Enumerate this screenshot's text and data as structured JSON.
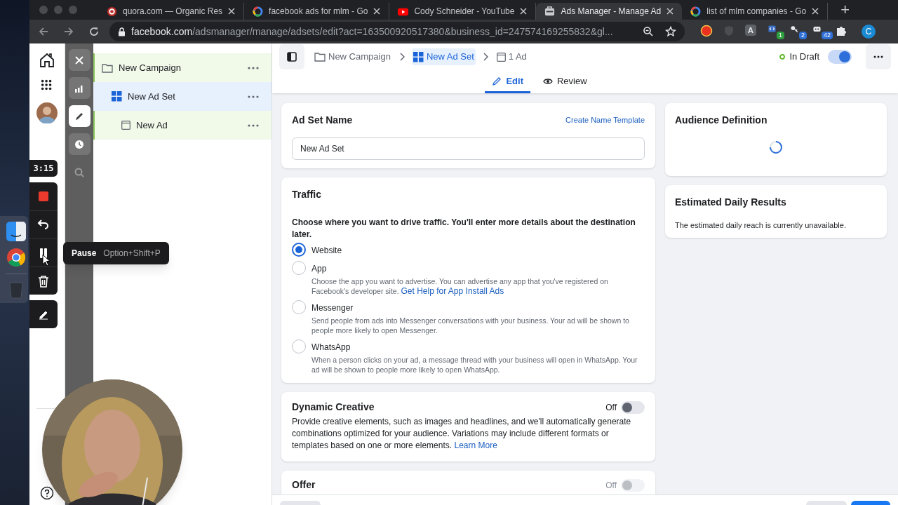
{
  "browser": {
    "tabs": [
      {
        "title": "quora.com — Organic Res",
        "kind": "quora",
        "selected": false
      },
      {
        "title": "facebook ads for mlm - Go",
        "kind": "google",
        "selected": false
      },
      {
        "title": "Cody Schneider - YouTube",
        "kind": "youtube",
        "selected": false
      },
      {
        "title": "Ads Manager - Manage Ad",
        "kind": "ads",
        "selected": true
      },
      {
        "title": "list of mlm companies - Go",
        "kind": "google",
        "selected": false
      }
    ],
    "new_tab": "+",
    "url": {
      "host": "facebook.com",
      "path": "/adsmanager/manage/adsets/edit?act=163500920517380&business_id=247574169255832&gl..."
    },
    "extensions": [
      {
        "kind": "record"
      },
      {
        "kind": "shield"
      },
      {
        "kind": "letter",
        "label": "A"
      },
      {
        "kind": "code",
        "badge": "1"
      },
      {
        "kind": "key",
        "badge": "2"
      },
      {
        "kind": "bot",
        "badge": "42"
      },
      {
        "kind": "puzzle"
      }
    ],
    "profile": "C"
  },
  "recorder": {
    "timer": "3:15",
    "tooltip": {
      "label": "Pause",
      "shortcut": "Option+Shift+P"
    }
  },
  "tools": [
    {
      "kind": "close",
      "selected": false
    },
    {
      "kind": "chart",
      "selected": false
    },
    {
      "kind": "edit",
      "selected": true
    },
    {
      "kind": "history",
      "selected": false
    },
    {
      "kind": "search",
      "selected": false
    }
  ],
  "tree": [
    {
      "label": "New Campaign",
      "kind": "campaign",
      "selected": false,
      "children": [
        {
          "label": "New Ad Set",
          "kind": "adset",
          "selected": true,
          "children": [
            {
              "label": "New Ad",
              "kind": "ad",
              "selected": false
            }
          ]
        }
      ]
    }
  ],
  "header": {
    "breadcrumbs": [
      {
        "label": "New Campaign",
        "kind": "campaign",
        "selected": false
      },
      {
        "label": "New Ad Set",
        "kind": "adset",
        "selected": true
      },
      {
        "label": "1 Ad",
        "kind": "ad",
        "selected": false
      }
    ],
    "status": "In Draft",
    "toggle_on": true,
    "tabs": [
      {
        "label": "Edit",
        "kind": "edit",
        "selected": true
      },
      {
        "label": "Review",
        "kind": "review",
        "selected": false
      }
    ]
  },
  "ad_set_name": {
    "title": "Ad Set Name",
    "link": "Create Name Template",
    "value": "New Ad Set"
  },
  "traffic": {
    "title": "Traffic",
    "prompt": "Choose where you want to drive traffic. You'll enter more details about the destination later.",
    "options": [
      {
        "label": "Website",
        "selected": true
      },
      {
        "label": "App",
        "selected": false,
        "description": "Choose the app you want to advertise. You can advertise any app that you've registered on Facebook's developer site.",
        "link": "Get Help for App Install Ads"
      },
      {
        "label": "Messenger",
        "selected": false,
        "description": "Send people from ads into Messenger conversations with your business. Your ad will be shown to people more likely to open Messenger."
      },
      {
        "label": "WhatsApp",
        "selected": false,
        "description": "When a person clicks on your ad, a message thread with your business will open in WhatsApp. Your ad will be shown to people more likely to open WhatsApp."
      }
    ]
  },
  "dynamic_creative": {
    "title": "Dynamic Creative",
    "toggle_label": "Off",
    "on": false,
    "disabled": false,
    "description": "Provide creative elements, such as images and headlines, and we'll automatically generate combinations optimized for your audience. Variations may include different formats or templates based on one or more elements.",
    "link": "Learn More"
  },
  "offer": {
    "title": "Offer",
    "toggle_label": "Off",
    "on": false,
    "disabled": true
  },
  "audience_definition": {
    "title": "Audience Definition",
    "loading": true
  },
  "estimated_daily_results": {
    "title": "Estimated Daily Results",
    "message": "The estimated daily reach is currently unavailable."
  }
}
